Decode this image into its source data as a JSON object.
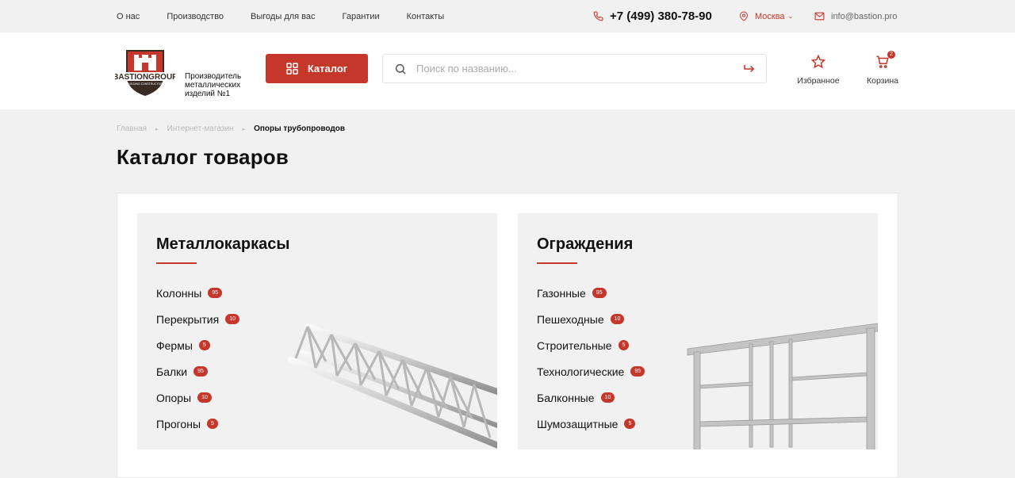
{
  "topnav": {
    "links": [
      "О нас",
      "Производство",
      "Выгоды для вас",
      "Гарантии",
      "Контакты"
    ],
    "phone": "+7 (499) 380-78-90",
    "city": "Москва",
    "email": "info@bastion.pro"
  },
  "header": {
    "logo_text": "BASTIONGROUP",
    "logo_subtext": "BUILDING CONSTRUCTION",
    "tagline": [
      "Производитель",
      "металлических",
      "изделий №1"
    ],
    "catalog_label": "Каталог",
    "search_placeholder": "Поиск по названию...",
    "favorites_label": "Избранное",
    "cart_label": "Корзина",
    "cart_count": "2"
  },
  "breadcrumb": [
    "Главная",
    "Интернет-магазин",
    "Опоры трубопроводов"
  ],
  "page_title": "Каталог товаров",
  "categories": [
    {
      "title": "Металлокаркасы",
      "items": [
        {
          "label": "Колонны",
          "count": "95"
        },
        {
          "label": "Перекрытия",
          "count": "10"
        },
        {
          "label": "Фермы",
          "count": "5"
        },
        {
          "label": "Балки",
          "count": "95"
        },
        {
          "label": "Опоры",
          "count": "10"
        },
        {
          "label": "Прогоны",
          "count": "5"
        }
      ]
    },
    {
      "title": "Ограждения",
      "items": [
        {
          "label": "Газонные",
          "count": "95"
        },
        {
          "label": "Пешеходные",
          "count": "10"
        },
        {
          "label": "Строительные",
          "count": "5"
        },
        {
          "label": "Технологические",
          "count": "95"
        },
        {
          "label": "Балконные",
          "count": "10"
        },
        {
          "label": "Шумозащитные",
          "count": "5"
        }
      ]
    }
  ],
  "colors": {
    "accent": "#c5362b",
    "page_bg": "#f1f1f1",
    "card_bg": "#f1f1f1"
  }
}
